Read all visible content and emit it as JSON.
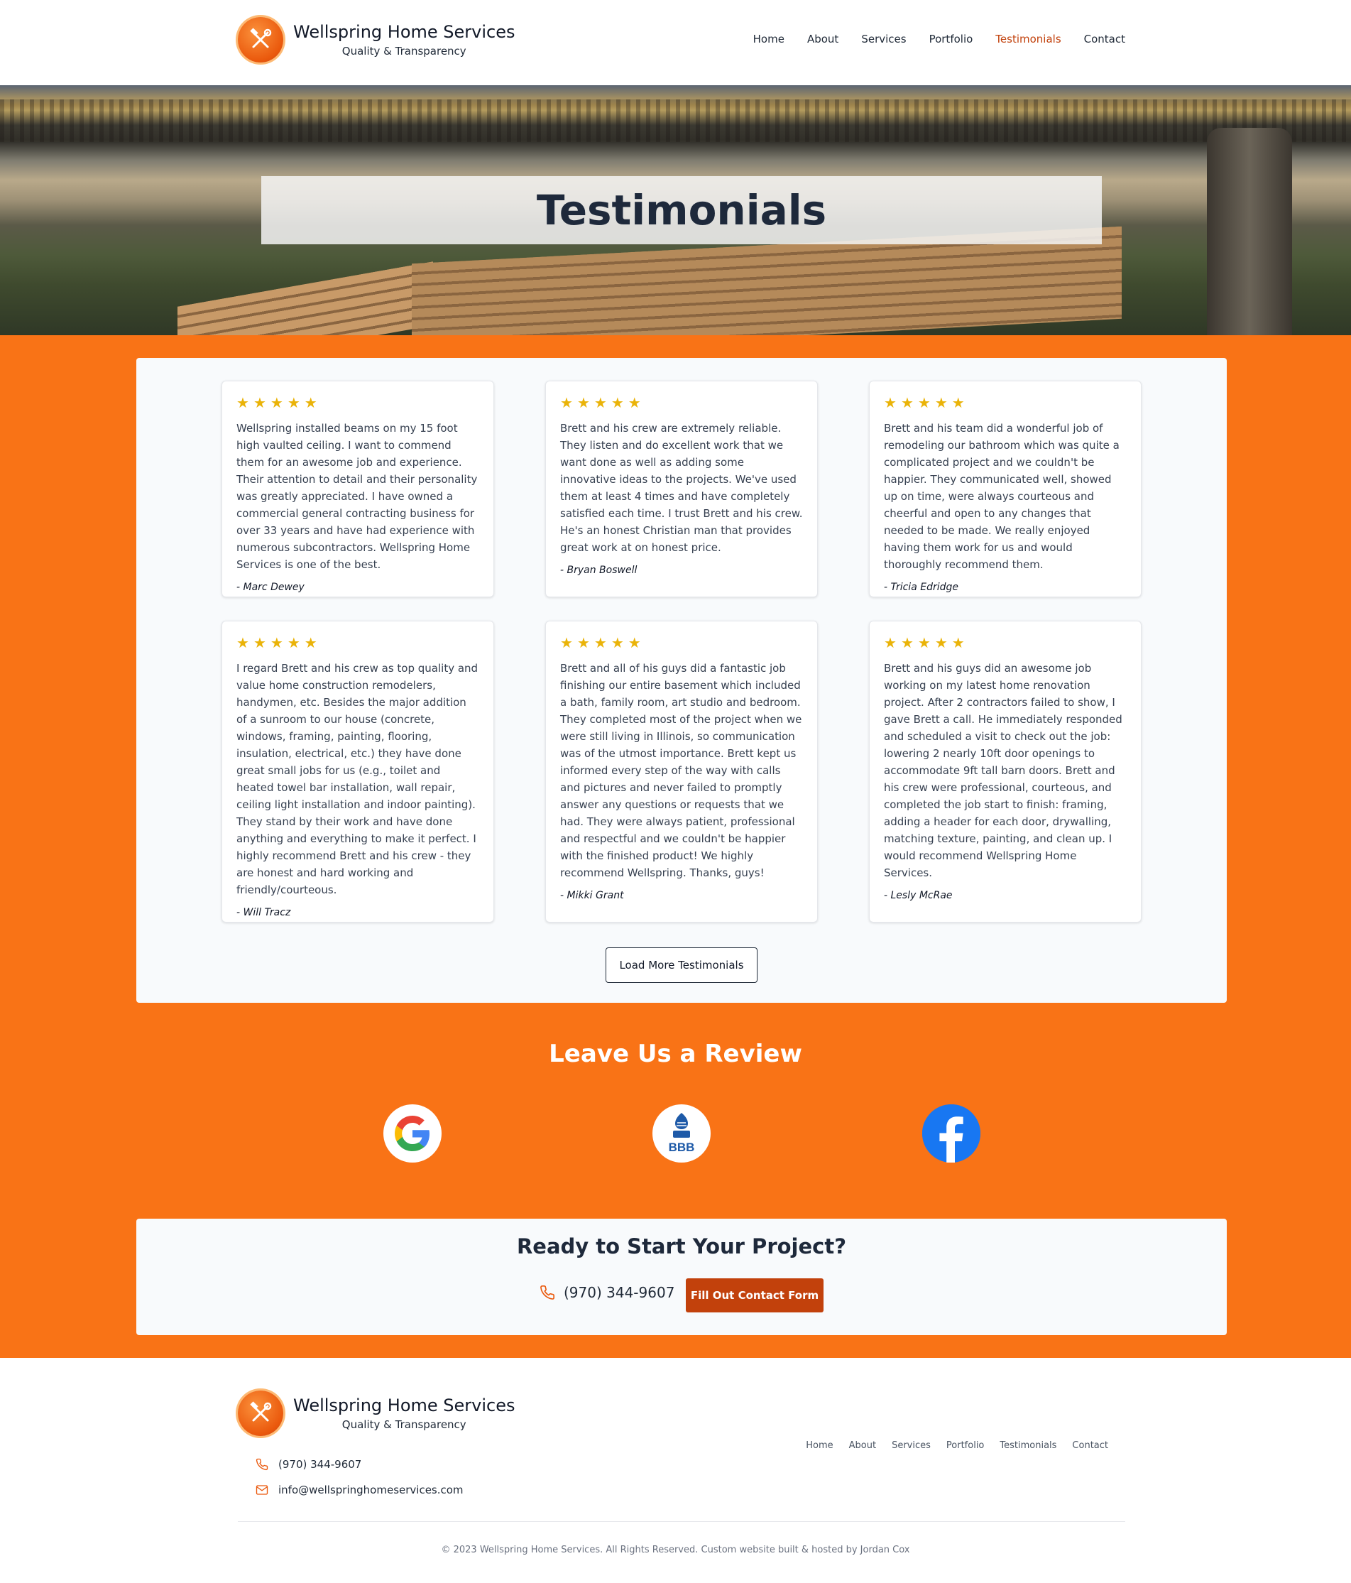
{
  "brand": {
    "name": "Wellspring Home Services",
    "tagline": "Quality & Transparency"
  },
  "nav": [
    "Home",
    "About",
    "Services",
    "Portfolio",
    "Testimonials",
    "Contact"
  ],
  "nav_active": "Testimonials",
  "hero": {
    "title": "Testimonials"
  },
  "testimonials": [
    {
      "rating": 5,
      "text": "Wellspring installed beams on my 15 foot high vaulted ceiling. I want to commend them for an awesome job and experience. Their attention to detail and their personality was greatly appreciated. I have owned a commercial general contracting business for over 33 years and have had experience with numerous subcontractors. Wellspring Home Services is one of the best.",
      "author": "- Marc Dewey"
    },
    {
      "rating": 5,
      "text": "Brett and his crew are extremely reliable. They listen and do excellent work that we want done as well as adding some innovative ideas to the projects. We've used them at least 4 times and have completely satisfied each time. I trust Brett and his crew. He's an honest Christian man that provides great work at on honest price.",
      "author": "- Bryan Boswell"
    },
    {
      "rating": 5,
      "text": "Brett and his team did a wonderful job of remodeling our bathroom which was quite a complicated project and we couldn't be happier. They communicated well, showed up on time, were always courteous and cheerful and open to any changes that needed to be made. We really enjoyed having them work for us and would thoroughly recommend them.",
      "author": "- Tricia Edridge"
    },
    {
      "rating": 5,
      "text": "I regard Brett and his crew as top quality and value home construction remodelers, handymen, etc. Besides the major addition of a sunroom to our house (concrete, windows, framing, painting, flooring, insulation, electrical, etc.) they have done great small jobs for us (e.g., toilet and heated towel bar installation, wall repair, ceiling light installation and indoor painting). They stand by their work and have done anything and everything to make it perfect. I highly recommend Brett and his crew - they are honest and hard working and friendly/courteous.",
      "author": "- Will Tracz"
    },
    {
      "rating": 5,
      "text": "Brett and all of his guys did a fantastic job finishing our entire basement which included a bath, family room, art studio and bedroom. They completed most of the project when we were still living in Illinois, so communication was of the utmost importance. Brett kept us informed every step of the way with calls and pictures and never failed to promptly answer any questions or requests that we had. They were always patient, professional and respectful and we couldn't be happier with the finished product! We highly recommend Wellspring. Thanks, guys!",
      "author": "- Mikki Grant"
    },
    {
      "rating": 5,
      "text": "Brett and his guys did an awesome job working on my latest home renovation project. After 2 contractors failed to show, I gave Brett a call. He immediately responded and scheduled a visit to check out the job: lowering 2 nearly 10ft door openings to accommodate 9ft tall barn doors. Brett and his crew were professional, courteous, and completed the job start to finish: framing, adding a header for each door, drywalling, matching texture, painting, and clean up. I would recommend Wellspring Home Services.",
      "author": "- Lesly McRae"
    }
  ],
  "load_more": "Load More Testimonials",
  "review": {
    "title": "Leave Us a Review",
    "icons": [
      "google-icon",
      "bbb-icon",
      "facebook-icon"
    ],
    "bbb_label": "BBB"
  },
  "cta": {
    "title": "Ready to Start Your Project?",
    "phone": "(970) 344-9607",
    "button": "Fill Out Contact Form"
  },
  "footer": {
    "phone": "(970) 344-9607",
    "email": "info@wellspringhomeservices.com",
    "nav": [
      "Home",
      "About",
      "Services",
      "Portfolio",
      "Testimonials",
      "Contact"
    ],
    "copyright": "© 2023 Wellspring Home Services. All Rights Reserved. Custom website built & hosted by Jordan Cox"
  },
  "colors": {
    "accent": "#f97316",
    "accent_dark": "#c2410c",
    "star": "#eab308",
    "panel": "#f8fafc"
  }
}
